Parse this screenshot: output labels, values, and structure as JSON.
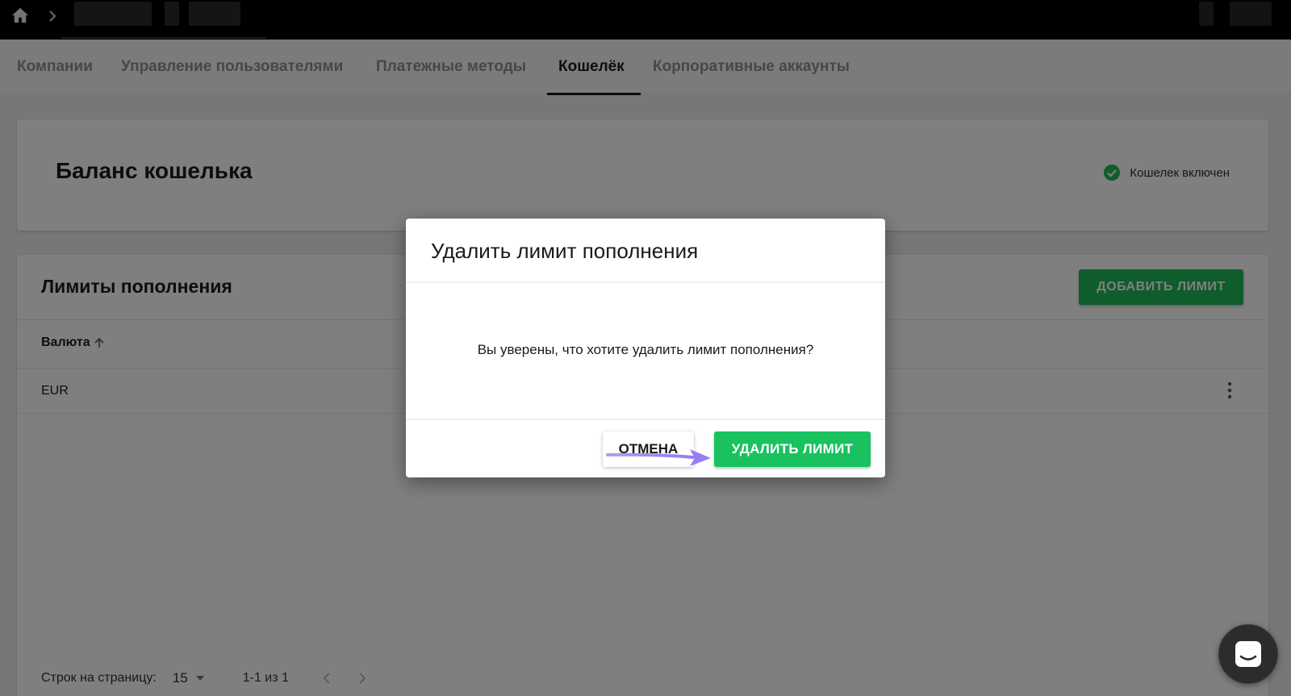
{
  "tabs": [
    {
      "label": "Компании"
    },
    {
      "label": "Управление пользователями"
    },
    {
      "label": "Платежные методы"
    },
    {
      "label": "Кошелёк"
    },
    {
      "label": "Корпоративные аккаунты"
    }
  ],
  "active_tab": "Кошелёк",
  "balance": {
    "title": "Баланс кошелька",
    "status_text": "Кошелек включен",
    "status_color": "#1fb85a"
  },
  "limits": {
    "title": "Лимиты пополнения",
    "add_button_label": "ДОБАВИТЬ ЛИМИТ",
    "column_currency": "Валюта",
    "rows": [
      {
        "currency": "EUR"
      }
    ],
    "pagination": {
      "rows_per_page_label": "Строк на страницу:",
      "rows_per_page_value": "15",
      "range": "1-1 из 1"
    }
  },
  "dialog": {
    "title": "Удалить лимит пополнения",
    "message": "Вы уверены, что хотите удалить лимит пополнения?",
    "cancel_label": "ОТМЕНА",
    "confirm_label": "УДАЛИТЬ ЛИМИТ",
    "confirm_color": "#19c25f"
  },
  "annotation": {
    "arrow_color": "#8a6df0"
  },
  "icons": [
    "home-icon",
    "chevron-right-icon",
    "check-circle-icon",
    "arrow-up-icon",
    "more-vert-icon",
    "caret-down-icon",
    "chevron-left-icon",
    "chat-icon"
  ]
}
